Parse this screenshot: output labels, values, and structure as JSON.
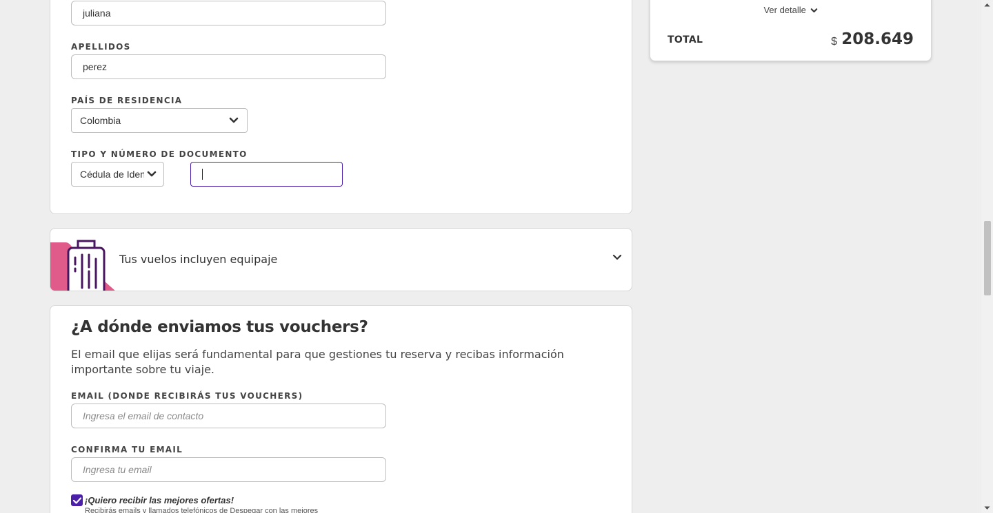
{
  "passenger_form": {
    "first_name_value": "juliana",
    "last_name_label": "APELLIDOS",
    "last_name_value": "perez",
    "country_label": "PAÍS DE RESIDENCIA",
    "country_value": "Colombia",
    "document_label": "TIPO Y NÚMERO DE DOCUMENTO",
    "document_type_value": "Cédula de Identidad",
    "document_number_value": ""
  },
  "baggage": {
    "title": "Tus vuelos incluyen equipaje",
    "icon": "luggage-icon"
  },
  "vouchers": {
    "heading": "¿A dónde enviamos tus vouchers?",
    "description": "El email que elijas será fundamental para que gestiones tu reserva y recibas información importante sobre tu viaje.",
    "email_label": "EMAIL (DONDE RECIBIRÁS TUS VOUCHERS)",
    "email_placeholder": "Ingresa el email de contacto",
    "confirm_label": "CONFIRMA TU EMAIL",
    "confirm_placeholder": "Ingresa tu email",
    "offers_label": "¡Quiero recibir las mejores ofertas!",
    "offers_sub": "Recibirás emails y llamados telefónicos de Despegar con las mejores",
    "offers_checked": true
  },
  "summary": {
    "detail_link": "Ver detalle",
    "total_label": "TOTAL",
    "currency": "$",
    "total_amount": "208.649"
  },
  "colors": {
    "accent": "#4b1fa8",
    "brand_pink": "#e05a8a",
    "luggage_purple": "#4a1560"
  }
}
